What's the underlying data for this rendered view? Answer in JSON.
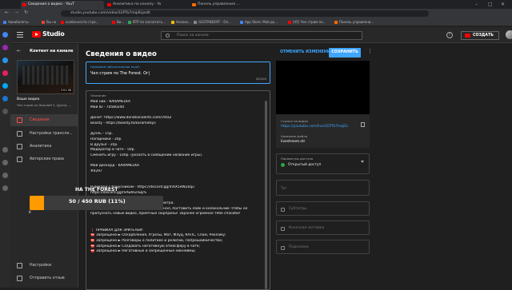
{
  "browser": {
    "tabs": [
      {
        "label": "Сведения о видео - YouT",
        "color": "#ff0000",
        "active": true
      },
      {
        "label": "Аналитика по каналу - Yo",
        "color": "#ff0000",
        "active": false
      },
      {
        "label": "Панель управления ...",
        "color": "#ff6b00",
        "active": false
      }
    ],
    "address": "studio.youtube.com/video/1EPTa7mqi6Ljedit",
    "bookmarks": [
      {
        "label": "Авиабилеты",
        "color": "#4285f4"
      },
      {
        "label": "Вы на",
        "color": "#ea4335"
      },
      {
        "label": "особенности стра...",
        "color": "#ff0000"
      },
      {
        "label": "Ви...",
        "color": "#ff0000"
      },
      {
        "label": "ВТР по заплатить...",
        "color": "#34a853"
      },
      {
        "label": "Анализ...",
        "color": "#fbbc05"
      },
      {
        "label": "GGSTANDOFF - Ол...",
        "color": "#888888"
      },
      {
        "label": "App Store: Мой до...",
        "color": "#4285f4"
      },
      {
        "label": "(45) Чел стрим по...",
        "color": "#ff0000"
      },
      {
        "label": "Панель управлени...",
        "color": "#ff6b00"
      }
    ]
  },
  "header": {
    "logo_text": "Studio",
    "search_placeholder": "Поиск на канале",
    "help_icon": "?",
    "create_label": "СОЗДАТЬ"
  },
  "sidebar": {
    "back_icon": "←",
    "title": "Контент на канале",
    "thumb_duration": "3:51:36",
    "video_label": "Ваше видео",
    "video_title": "Чел стрим по Standoff 2, Дуэли, ...",
    "items": [
      {
        "label": "Сведения",
        "active": true
      },
      {
        "label": "Настройки трансля...",
        "active": false
      },
      {
        "label": "Аналитика",
        "active": false
      },
      {
        "label": "Авторские права",
        "active": false
      }
    ],
    "bottom_items": [
      {
        "label": "Настройки"
      },
      {
        "label": "Отправить отзыв"
      }
    ]
  },
  "overlay": {
    "title": "НА THE FOREST",
    "amount": "50 / 450 RUB (11%)",
    "start": "0",
    "progress": 0.11
  },
  "main": {
    "page_title": "Сведения о видео",
    "undo_label": "ОТМЕНИТЬ ИЗМЕНЕНИЯ",
    "save_label": "СОХРАНИТЬ",
    "more_icon": "⋮",
    "title_field": {
      "label": "Название (обязательное поле)",
      "value": "Чел стрим по The Forest. Ог|",
      "counter": "29/100"
    },
    "description": {
      "label": "Описание",
      "lines": [
        "Мой ник - KARAMELKA",
        "Мой ID - 70580240",
        "",
        "Донат: https://www.donationalerts.com/r/sta2",
        "Boosty - https://boosty.to/karamelkys",
        "",
        "Дуэль - 15р.",
        "Напарники - 20р.",
        "В друзья - 20р.",
        "Модератор в чате - 50р.",
        "Сменить игру - 100р. (указать в сообщении название игры).",
        "",
        "Мой дискорд - KARAMELKA",
        "#4297",
        "",
        "",
        "Р-дикорд с бонусником - https://discord.gg/mAX5eWZkqu",
        "                   https://discord.gg/mAw9GnSqrS",
        "",
        "Рад тебя видеть, приятного тебе просмотра.",
        "Не забудь подписаться на мой ютуб канал, поставить лайк и колокольчик чтобы не",
        "пропускать новые видео, приятные сюрпризы! Заранее огромное тебе спасибо!",
        "",
        "",
        "❗ ПРАВИЛА ДЛЯ ЗРИТЕЛЕЙ:",
        "  ⛔ Запрещено ► Оскорбления, Угрозы, Мат, Флуд, КАПС, Спам, Рекламу;",
        "  ⛔ Запрещено ► Разговоры о политике и религии, Попрошайничество;",
        "  ⛔ Запрещено ► Создавать негативную атмосферу в чате;",
        "  ⛔ Запрещено ► Негативные и запрещённые никнеймы;"
      ]
    }
  },
  "right": {
    "link_label": "Ссылка на видео",
    "link_value": "https://youtube.com/live/1EPTa7mqiEc",
    "file_label": "Название файла",
    "file_value": "livestream.str",
    "access_label": "Параметры доступа",
    "access_value": "Открытый доступ",
    "access_color": "#2ba640",
    "tag_placeholder": "Тег",
    "subtitles_placeholder": "Субтитры",
    "endscreen_placeholder": "Конечная заставка",
    "hints_placeholder": "Подсказки"
  }
}
